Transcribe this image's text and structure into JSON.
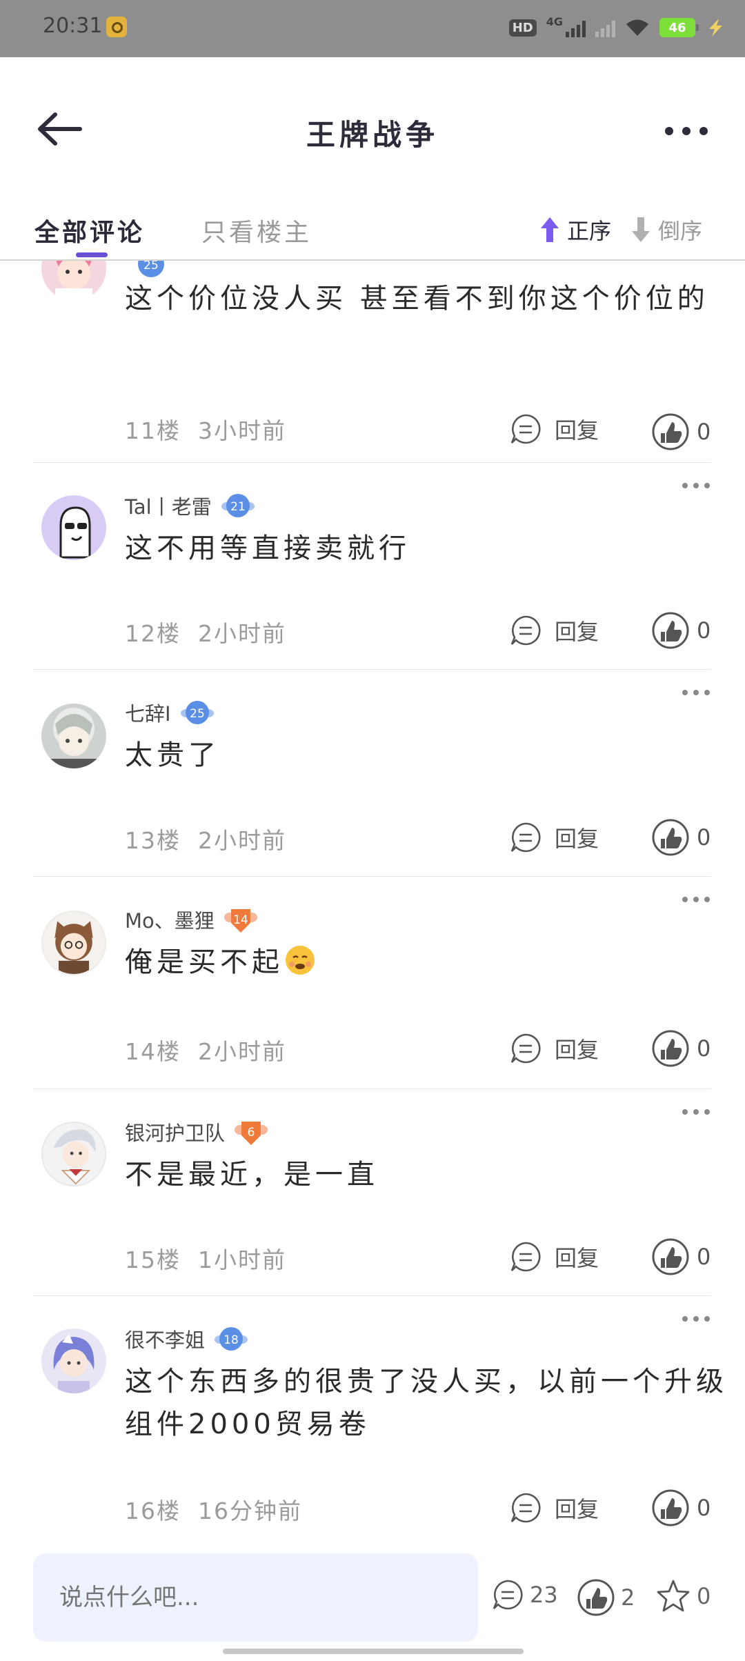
{
  "status_bar": {
    "time": "20:31",
    "hd": "HD",
    "network": "4G",
    "battery": "46"
  },
  "header": {
    "title": "王牌战争",
    "back_icon": "back-arrow-icon",
    "more_icon": "more-horizontal-icon"
  },
  "tabs": {
    "all": "全部评论",
    "owner_only": "只看楼主",
    "sort_asc": "正序",
    "sort_desc": "倒序",
    "accent": "#6a4fd6"
  },
  "comments": [
    {
      "user": "",
      "level": "25",
      "text": "这个价位没人买 甚至看不到你这个价位的",
      "floor": "11楼",
      "time": "3小时前",
      "reply": "回复",
      "likes": "0"
    },
    {
      "user": "Tal丨老雷",
      "level": "21",
      "text": "这不用等直接卖就行",
      "floor": "12楼",
      "time": "2小时前",
      "reply": "回复",
      "likes": "0"
    },
    {
      "user": "七辞I",
      "level": "25",
      "text": "太贵了",
      "floor": "13楼",
      "time": "2小时前",
      "reply": "回复",
      "likes": "0"
    },
    {
      "user": "Mo、墨狸",
      "level": "14",
      "text": "俺是买不起",
      "floor": "14楼",
      "time": "2小时前",
      "reply": "回复",
      "likes": "0"
    },
    {
      "user": "银河护卫队",
      "level": "6",
      "text": "不是最近，是一直",
      "floor": "15楼",
      "time": "1小时前",
      "reply": "回复",
      "likes": "0"
    },
    {
      "user": "很不李姐",
      "level": "18",
      "text": "这个东西多的很贵了没人买，以前一个升级组件2000贸易卷",
      "floor": "16楼",
      "time": "16分钟前",
      "reply": "回复",
      "likes": "0"
    }
  ],
  "bottom_bar": {
    "placeholder": "说点什么吧...",
    "comments_count": "23",
    "likes_count": "2",
    "favorites_count": "0"
  }
}
